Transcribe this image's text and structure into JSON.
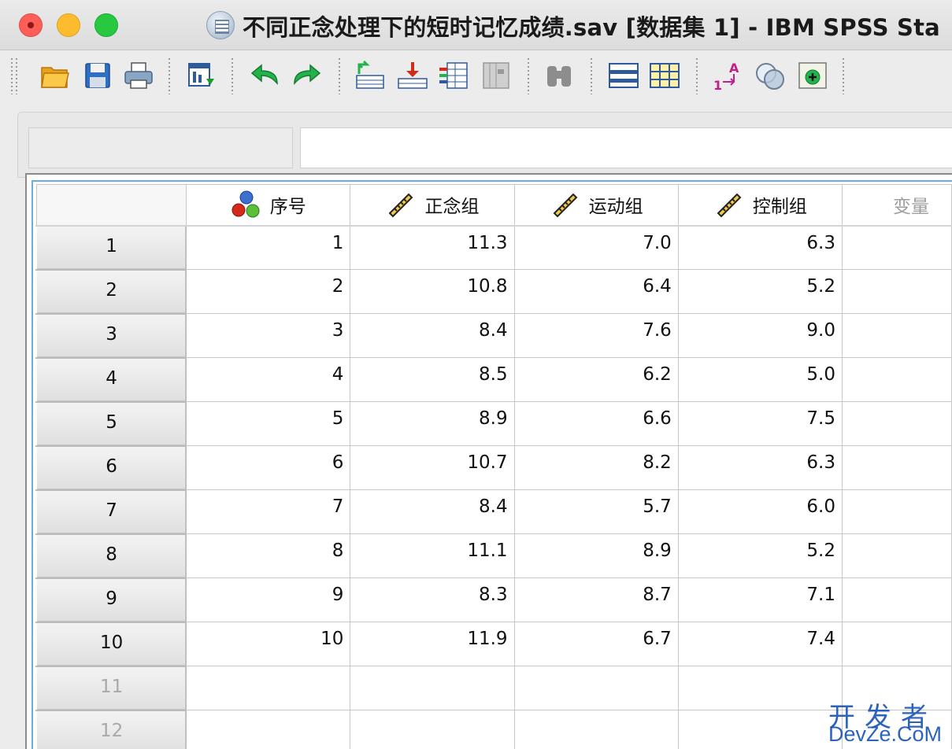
{
  "window": {
    "title": "不同正念处理下的短时记忆成绩.sav [数据集 1] - IBM SPSS Sta"
  },
  "toolbar": {
    "buttons": [
      {
        "name": "open-icon"
      },
      {
        "name": "save-icon"
      },
      {
        "name": "print-icon"
      },
      {
        "name": "recall-dialog-icon"
      },
      {
        "name": "undo-icon"
      },
      {
        "name": "redo-icon"
      },
      {
        "name": "goto-case-icon"
      },
      {
        "name": "goto-variable-icon"
      },
      {
        "name": "variables-icon"
      },
      {
        "name": "run-descriptives-icon"
      },
      {
        "name": "find-icon"
      },
      {
        "name": "insert-cases-icon"
      },
      {
        "name": "insert-variable-icon"
      },
      {
        "name": "value-labels-icon"
      },
      {
        "name": "use-variable-sets-icon"
      },
      {
        "name": "show-all-variables-icon"
      }
    ]
  },
  "grid": {
    "columns": [
      {
        "label": "序号",
        "icon": "nominal-icon"
      },
      {
        "label": "正念组",
        "icon": "scale-ruler-icon"
      },
      {
        "label": "运动组",
        "icon": "scale-ruler-icon"
      },
      {
        "label": "控制组",
        "icon": "scale-ruler-icon"
      }
    ],
    "empty_column_label": "变量",
    "rows": [
      {
        "row": "1",
        "cells": [
          "1",
          "11.3",
          "7.0",
          "6.3"
        ]
      },
      {
        "row": "2",
        "cells": [
          "2",
          "10.8",
          "6.4",
          "5.2"
        ]
      },
      {
        "row": "3",
        "cells": [
          "3",
          "8.4",
          "7.6",
          "9.0"
        ]
      },
      {
        "row": "4",
        "cells": [
          "4",
          "8.5",
          "6.2",
          "5.0"
        ]
      },
      {
        "row": "5",
        "cells": [
          "5",
          "8.9",
          "6.6",
          "7.5"
        ]
      },
      {
        "row": "6",
        "cells": [
          "6",
          "10.7",
          "8.2",
          "6.3"
        ]
      },
      {
        "row": "7",
        "cells": [
          "7",
          "8.4",
          "5.7",
          "6.0"
        ]
      },
      {
        "row": "8",
        "cells": [
          "8",
          "11.1",
          "8.9",
          "5.2"
        ]
      },
      {
        "row": "9",
        "cells": [
          "9",
          "8.3",
          "8.7",
          "7.1"
        ]
      },
      {
        "row": "10",
        "cells": [
          "10",
          "11.9",
          "6.7",
          "7.4"
        ]
      },
      {
        "row": "11",
        "cells": [
          "",
          "",
          "",
          ""
        ]
      },
      {
        "row": "12",
        "cells": [
          "",
          "",
          "",
          ""
        ]
      }
    ]
  },
  "watermark": {
    "line1": "开发者",
    "line2": "DevZe.CoM"
  },
  "colors": {
    "grid_focus_border": "#6aaede",
    "watermark": "#1b56b8"
  }
}
